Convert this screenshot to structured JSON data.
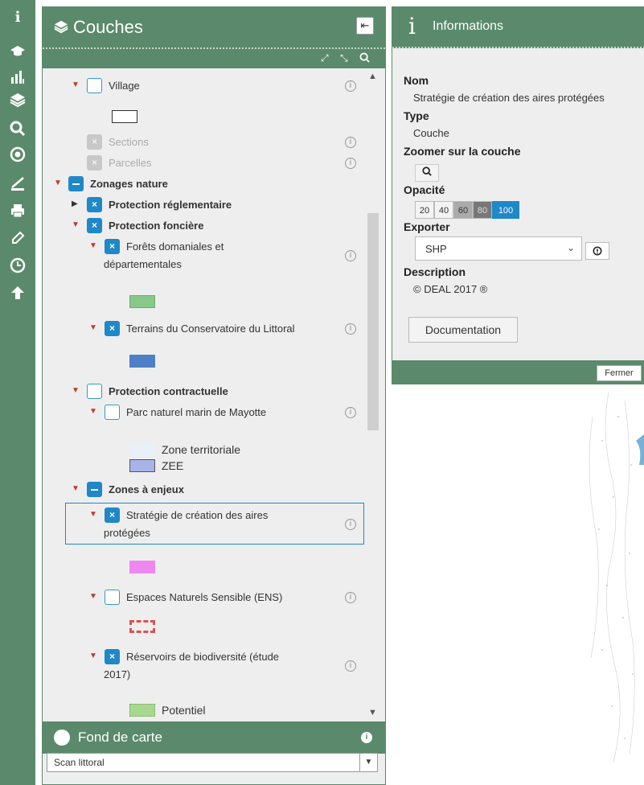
{
  "couches": {
    "title": "Couches",
    "collapse_glyph": "⇤",
    "tree": [
      {
        "key": "village",
        "label": "Village",
        "level": 1,
        "state": "unchecked",
        "bold": false
      },
      {
        "key": "sections",
        "label": "Sections",
        "level": 1,
        "state": "disabled",
        "bold": false
      },
      {
        "key": "parcelles",
        "label": "Parcelles",
        "level": 1,
        "state": "disabled",
        "bold": false
      },
      {
        "key": "zonages",
        "label": "Zonages nature",
        "level": 0,
        "state": "partial",
        "bold": true
      },
      {
        "key": "protection_reg",
        "label": "Protection réglementaire",
        "level": 1,
        "state": "checked",
        "bold": true
      },
      {
        "key": "protection_fonc",
        "label": "Protection foncière",
        "level": 1,
        "state": "checked",
        "bold": true
      },
      {
        "key": "forets",
        "label_line1": "Forêts domaniales et",
        "label_line2": "départementales",
        "level": 2,
        "state": "checked"
      },
      {
        "key": "terrains",
        "label": "Terrains du Conservatoire du Littoral",
        "level": 2,
        "state": "checked"
      },
      {
        "key": "protection_contr",
        "label": "Protection contractuelle",
        "level": 1,
        "state": "unchecked",
        "bold": true
      },
      {
        "key": "parc",
        "label": "Parc naturel marin de Mayotte",
        "level": 2,
        "state": "unchecked"
      },
      {
        "key": "zones_enjeux",
        "label": "Zones à enjeux",
        "level": 1,
        "state": "partial",
        "bold": true
      },
      {
        "key": "strategie",
        "label_line1": "Stratégie de création des aires",
        "label_line2": "protégées",
        "level": 2,
        "state": "checked"
      },
      {
        "key": "ens",
        "label": "Espaces Naturels Sensible (ENS)",
        "level": 2,
        "state": "unchecked"
      },
      {
        "key": "reservoirs",
        "label_line1": "Réservoirs de biodiversité (étude",
        "label_line2": "2017)",
        "level": 2,
        "state": "checked"
      }
    ],
    "legend": {
      "zone_territoriale": "Zone territoriale",
      "zee": "ZEE",
      "potentiel": "Potentiel"
    }
  },
  "fond_de_carte": {
    "title": "Fond de carte",
    "selected": "Scan littoral"
  },
  "informations": {
    "title": "Informations",
    "nom_label": "Nom",
    "nom_value": "Stratégie de création des aires protégées",
    "type_label": "Type",
    "type_value": "Couche",
    "zoom_label": "Zoomer sur la couche",
    "opacite_label": "Opacité",
    "opacity_options": [
      "20",
      "40",
      "60",
      "80",
      "100"
    ],
    "opacity_selected": "100",
    "exporter_label": "Exporter",
    "export_value": "SHP",
    "description_label": "Description",
    "description_value": "© DEAL 2017 ®",
    "documentation_label": "Documentation",
    "fermer_label": "Fermer"
  },
  "colors": {
    "panel_green": "#5a8a6b",
    "checkbox_blue": "#1e88c8",
    "caret_red": "#c0392b",
    "swatch_forets": "#88c98a",
    "swatch_terrains": "#4f7fc4",
    "swatch_zone_territoriale": "#e8f0f8",
    "swatch_zee": "#a8b4e8",
    "swatch_strategie": "#ee88ee",
    "swatch_ens": "#e05050",
    "swatch_potentiel": "#a8d890"
  }
}
